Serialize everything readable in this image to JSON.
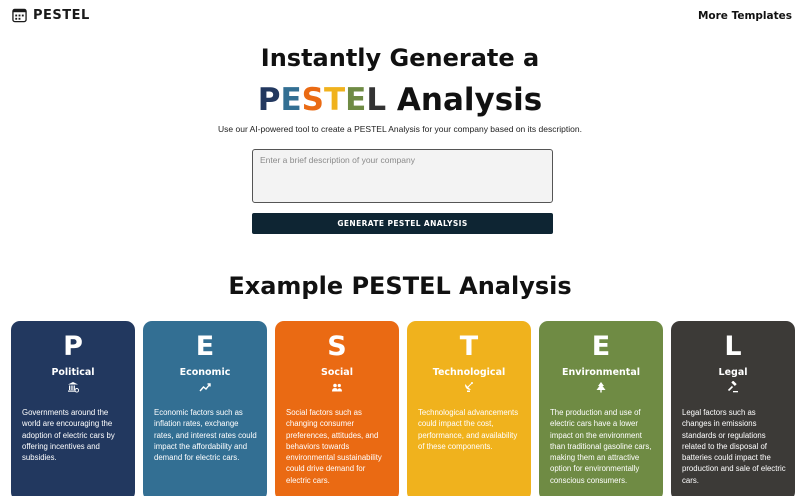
{
  "header": {
    "logo_icon": "calendar-grid-icon",
    "logo_text": "PESTEL",
    "more_templates": "More Templates"
  },
  "hero": {
    "title_line1": "Instantly Generate a",
    "title_letters": [
      "P",
      "E",
      "S",
      "T",
      "E",
      "L"
    ],
    "title_suffix": "Analysis",
    "subtitle": "Use our AI-powered tool to create a PESTEL Analysis for your company based on its description."
  },
  "form": {
    "placeholder": "Enter a brief description of your company",
    "value": "",
    "button_label": "GENERATE PESTEL ANALYSIS"
  },
  "example": {
    "title": "Example PESTEL Analysis",
    "cards": [
      {
        "letter": "P",
        "name": "Political",
        "icon": "government-building-icon",
        "color": "#22385f",
        "text": "Governments around the world are encouraging the adoption of electric cars by offering incentives and subsidies."
      },
      {
        "letter": "E",
        "name": "Economic",
        "icon": "trend-line-icon",
        "color": "#336f93",
        "text": "Economic factors such as inflation rates, exchange rates, and interest rates could impact the affordability and demand for electric cars."
      },
      {
        "letter": "S",
        "name": "Social",
        "icon": "people-icon",
        "color": "#ea6a13",
        "text": "Social factors such as changing consumer preferences, attitudes, and behaviors towards environmental sustainability could drive demand for electric cars."
      },
      {
        "letter": "T",
        "name": "Technological",
        "icon": "satellite-dish-icon",
        "color": "#f0b21d",
        "text": "Technological advancements could impact the cost, performance, and availability of these components."
      },
      {
        "letter": "E",
        "name": "Environmental",
        "icon": "tree-icon",
        "color": "#6f8b44",
        "text": "The production and use of electric cars have a lower impact on the environment than traditional gasoline cars, making them an attractive option for environmentally conscious consumers."
      },
      {
        "letter": "L",
        "name": "Legal",
        "icon": "gavel-icon",
        "color": "#3c3a37",
        "text": "Legal factors such as changes in emissions standards or regulations related to the disposal of batteries could impact the production and sale of electric cars."
      }
    ]
  }
}
